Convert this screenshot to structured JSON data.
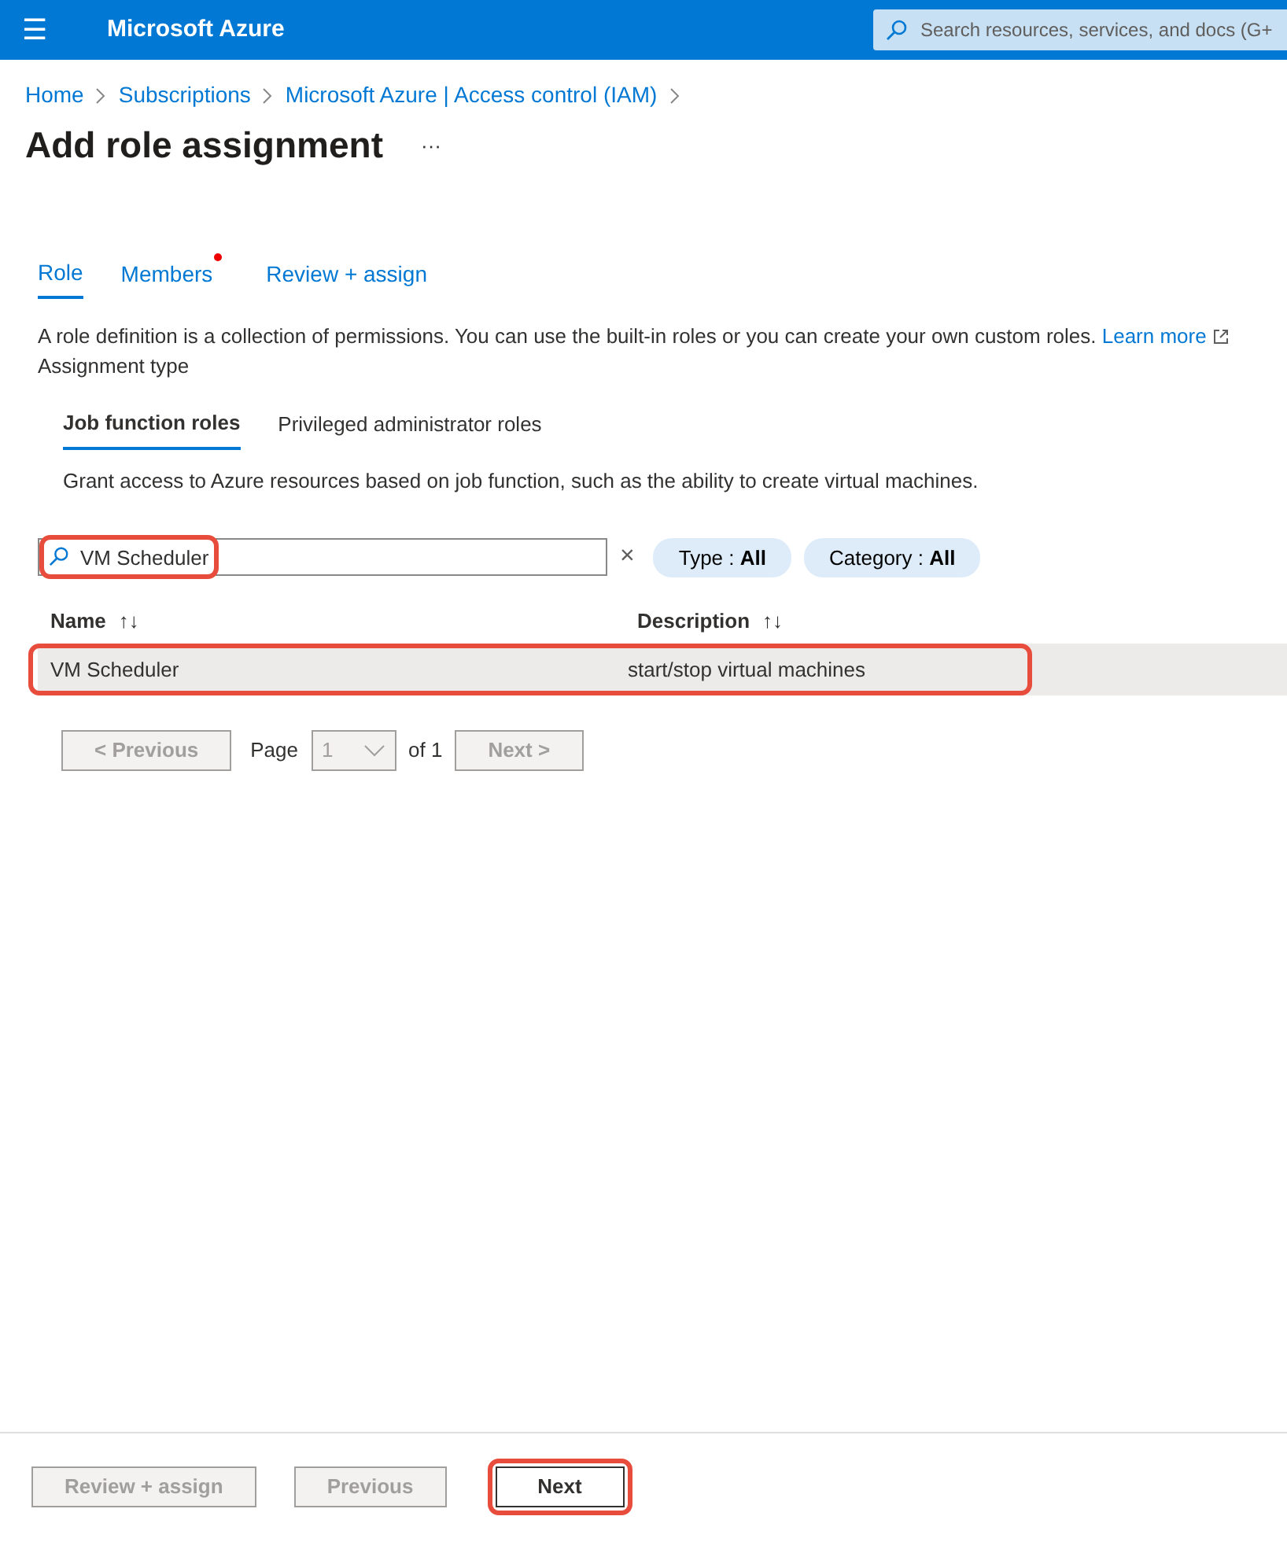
{
  "topbar": {
    "menu": "☰",
    "title": "Microsoft Azure",
    "search": {
      "placeholder": "Search resources, services, and docs (G+"
    }
  },
  "breadcrumb": [
    "Home",
    "Subscriptions",
    "Microsoft Azure | Access control (IAM)"
  ],
  "page_title": "Add role assignment",
  "more": "···",
  "tabs": [
    {
      "label": "Role",
      "selected": true,
      "attention": false
    },
    {
      "label": "Members",
      "selected": false,
      "attention": true
    },
    {
      "label": "Review + assign",
      "selected": false,
      "attention": false
    }
  ],
  "description": "A role definition is a collection of permissions. You can use the built-in roles or you can create your own custom roles.",
  "learn_more": "Learn more",
  "assignment_type_label": "Assignment type",
  "subtabs": [
    {
      "label": "Job function roles",
      "selected": true
    },
    {
      "label": "Privileged administrator roles",
      "selected": false
    }
  ],
  "subtab_description": "Grant access to Azure resources based on job function, such as the ability to create virtual machines.",
  "search": {
    "value": "VM Scheduler",
    "highlighted": true,
    "clear": "×"
  },
  "filters": [
    {
      "label": "Type : ",
      "value": "All"
    },
    {
      "label": "Category : ",
      "value": "All"
    }
  ],
  "table": {
    "columns": [
      {
        "label": "Name",
        "sort": "↑↓"
      },
      {
        "label": "Description",
        "sort": "↑↓"
      }
    ],
    "rows": [
      {
        "cells": [
          "VM Scheduler",
          "start/stop virtual machines"
        ],
        "selected": true,
        "highlighted": true
      }
    ]
  },
  "pagination": {
    "previous": "< Previous",
    "page_label": "Page",
    "page": "1",
    "of": "of 1",
    "next": "Next >"
  },
  "footer": [
    {
      "label": "Review + assign",
      "disabled": true,
      "highlighted": false
    },
    {
      "label": "Previous",
      "disabled": true,
      "highlighted": false
    },
    {
      "label": "Next",
      "disabled": false,
      "highlighted": true
    }
  ]
}
